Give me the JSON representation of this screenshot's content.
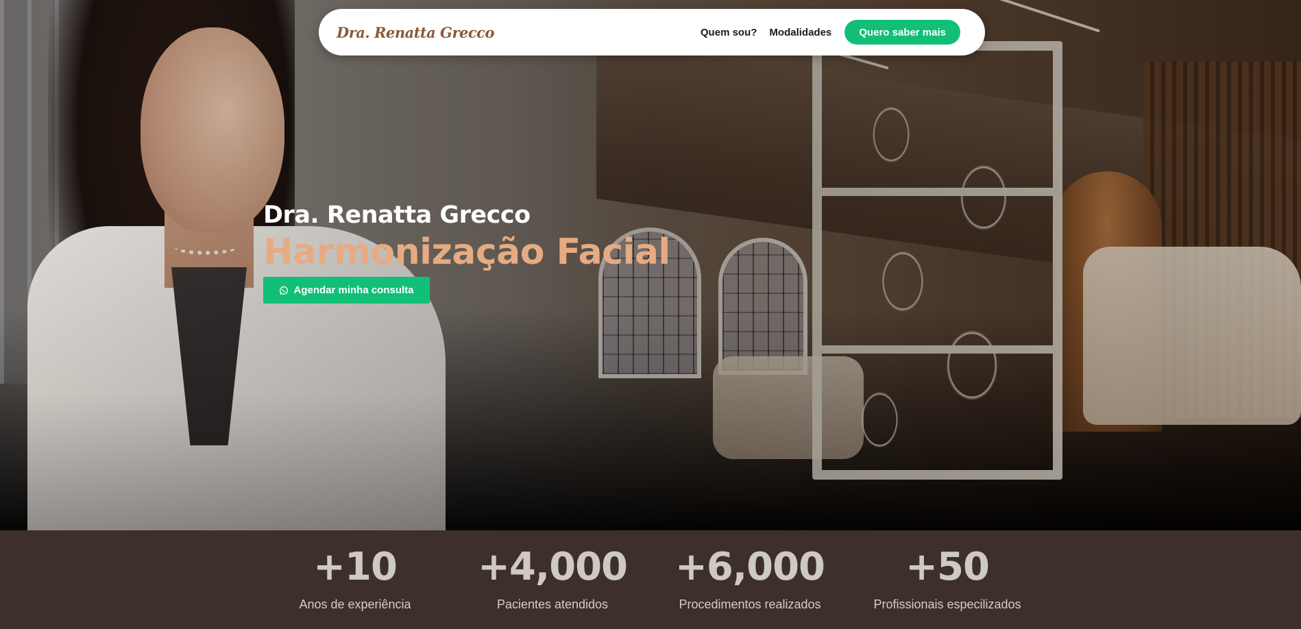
{
  "navbar": {
    "logo": "Dra. Renatta Grecco",
    "links": [
      {
        "label": "Quem sou?"
      },
      {
        "label": "Modalidades"
      }
    ],
    "cta_label": "Quero saber mais"
  },
  "hero": {
    "name": "Dra. Renatta Grecco",
    "title": "Harmonização Facial",
    "cta_label": "Agendar minha consulta",
    "cta_icon": "whatsapp-icon"
  },
  "stats": [
    {
      "value": "+10",
      "label": "Anos de experiência"
    },
    {
      "value": "+4,000",
      "label": "Pacientes atendidos"
    },
    {
      "value": "+6,000",
      "label": "Procedimentos realizados"
    },
    {
      "value": "+50",
      "label": "Profissionais especilizados"
    }
  ],
  "colors": {
    "accent_green": "#11bf77",
    "title_peach": "#e6ab82",
    "stats_background": "#3d302b",
    "logo_brown": "#8a5a3a"
  }
}
